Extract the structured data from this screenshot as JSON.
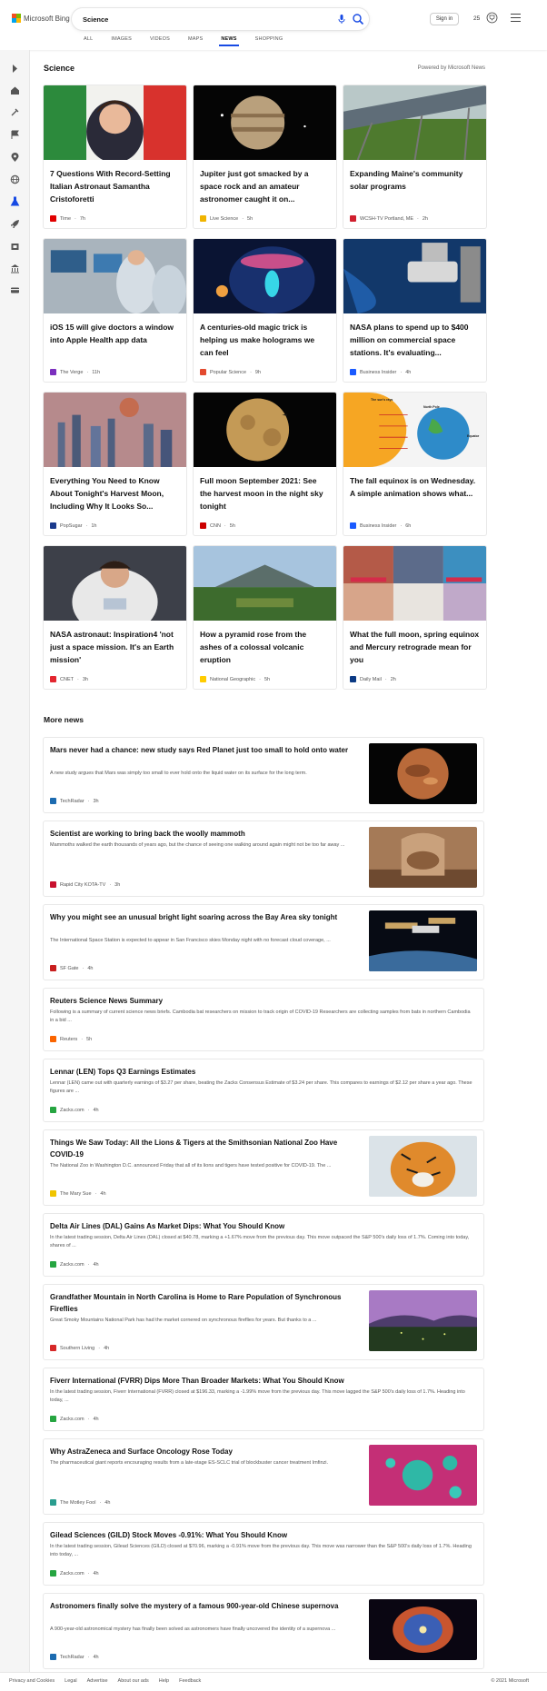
{
  "brand": {
    "name": "Microsoft Bing",
    "colors": [
      "#f25022",
      "#7fba00",
      "#00a4ef",
      "#ffb900"
    ]
  },
  "search": {
    "query": "Science"
  },
  "header": {
    "signin_label": "Sign in",
    "points": "25"
  },
  "tabs": [
    {
      "label": "ALL",
      "active": false
    },
    {
      "label": "IMAGES",
      "active": false
    },
    {
      "label": "VIDEOS",
      "active": false
    },
    {
      "label": "MAPS",
      "active": false
    },
    {
      "label": "NEWS",
      "active": true
    },
    {
      "label": "SHOPPING",
      "active": false
    }
  ],
  "rail_icons": [
    "expand-arrow-icon",
    "home-icon",
    "tools-icon",
    "flag-icon",
    "location-pin-icon",
    "globe-icon",
    "flask-icon",
    "rocket-icon",
    "film-icon",
    "bank-icon",
    "card-icon"
  ],
  "section": {
    "title": "Science",
    "powered_by": "Powered by Microsoft News"
  },
  "cards": [
    {
      "title": "7 Questions With Record-Setting Italian Astronaut Samantha Cristoforetti",
      "source": "Time",
      "age": "7h",
      "logo_color": "#e10000",
      "img": "astronaut-portrait"
    },
    {
      "title": "Jupiter just got smacked by a space rock and an amateur astronomer caught it on...",
      "source": "Live Science",
      "age": "5h",
      "logo_color": "#f0b400",
      "img": "jupiter"
    },
    {
      "title": "Expanding Maine's community solar programs",
      "source": "WCSH-TV Portland, ME",
      "age": "2h",
      "logo_color": "#d01f2e",
      "img": "solar"
    },
    {
      "title": "iOS 15 will give doctors a window into Apple Health app data",
      "source": "The Verge",
      "age": "11h",
      "logo_color": "#7b2fbe",
      "img": "lab"
    },
    {
      "title": "A centuries-old magic trick is helping us make holograms we can feel",
      "source": "Popular Science",
      "age": "9h",
      "logo_color": "#e34a2f",
      "img": "hologram"
    },
    {
      "title": "NASA plans to spend up to $400 million on commercial space stations. It's evaluating...",
      "source": "Business Insider",
      "age": "4h",
      "logo_color": "#1a5aff",
      "img": "station"
    },
    {
      "title": "Everything You Need to Know About Tonight's Harvest Moon, Including Why It Looks So...",
      "source": "PopSugar",
      "age": "1h",
      "logo_color": "#1b3a8c",
      "img": "city-moon"
    },
    {
      "title": "Full moon September 2021: See the harvest moon in the night sky tonight",
      "source": "CNN",
      "age": "5h",
      "logo_color": "#cc0000",
      "img": "full-moon"
    },
    {
      "title": "The fall equinox is on Wednesday. A simple animation shows what...",
      "source": "Business Insider",
      "age": "6h",
      "logo_color": "#1a5aff",
      "img": "equinox"
    },
    {
      "title": "NASA astronaut: Inspiration4 'not just a space mission. It's an Earth mission'",
      "source": "CNET",
      "age": "3h",
      "logo_color": "#e3262f",
      "img": "suit"
    },
    {
      "title": "How a pyramid rose from the ashes of a colossal volcanic eruption",
      "source": "National Geographic",
      "age": "5h",
      "logo_color": "#ffcc00",
      "img": "volcano"
    },
    {
      "title": "What the full moon, spring equinox and Mercury retrograde mean for you",
      "source": "Daily Mail",
      "age": "2h",
      "logo_color": "#0b3a84",
      "img": "collage"
    }
  ],
  "equinox_labels": {
    "sun_rays": "The sun's rays",
    "north_pole": "North Pole",
    "equator": "Equator"
  },
  "more_news": {
    "title": "More news",
    "items": [
      {
        "title": "Mars never had a chance: new study says Red Planet just too small to hold onto water",
        "snippet": "A new study argues that Mars was simply too small to ever hold onto the liquid water on its surface for the long term.",
        "source": "TechRadar",
        "age": "3h",
        "logo_color": "#1c6bb0",
        "img": "mars"
      },
      {
        "title": "Scientist are working to bring back the woolly mammoth",
        "snippet": "Mammoths walked the earth thousands of years ago, but the chance of seeing one walking around again might not be too far away ...",
        "source": "Rapid City KOTA-TV",
        "age": "3h",
        "logo_color": "#c8102e",
        "img": "museum"
      },
      {
        "title": "Why you might see an unusual bright light soaring across the Bay Area sky tonight",
        "snippet": "The International Space Station is expected to appear in San Francisco skies Monday night with no forecast cloud coverage, ...",
        "source": "SF Gate",
        "age": "4h",
        "logo_color": "#c81e1e",
        "img": "iss"
      },
      {
        "title": "Reuters Science News Summary",
        "snippet": "Following is a summary of current science news briefs. Cambodia bat researchers on mission to track origin of COVID-19 Researchers are collecting samples from bats in northern Cambodia in a bid ...",
        "source": "Reuters",
        "age": "5h",
        "logo_color": "#fa6400",
        "img": ""
      },
      {
        "title": "Lennar (LEN) Tops Q3 Earnings Estimates",
        "snippet": "Lennar (LEN) came out with quarterly earnings of $3.27 per share, beating the Zacks Consensus Estimate of $3.24 per share. This compares to earnings of $2.12 per share a year ago. These figures are ...",
        "source": "Zacks.com",
        "age": "4h",
        "logo_color": "#26a541",
        "img": ""
      },
      {
        "title": "Things We Saw Today: All the Lions & Tigers at the Smithsonian National Zoo Have COVID-19",
        "snippet": "The National Zoo in Washington D.C. announced Friday that all of its lions and tigers have tested positive for COVID-19. The ...",
        "source": "The Mary Sue",
        "age": "4h",
        "logo_color": "#f0c400",
        "img": "tiger"
      },
      {
        "title": "Delta Air Lines (DAL) Gains As Market Dips: What You Should Know",
        "snippet": "In the latest trading session, Delta Air Lines (DAL) closed at $40.78, marking a +1.67% move from the previous day. This move outpaced the S&P 500's daily loss of 1.7%. Coming into today, shares of ...",
        "source": "Zacks.com",
        "age": "4h",
        "logo_color": "#26a541",
        "img": ""
      },
      {
        "title": "Grandfather Mountain in North Carolina is Home to Rare Population of Synchronous Fireflies",
        "snippet": "Great Smoky Mountains National Park has had the market cornered on synchronous fireflies for years. But thanks to a ...",
        "source": "Southern Living",
        "age": "4h",
        "logo_color": "#d62828",
        "img": "fireflies"
      },
      {
        "title": "Fiverr International (FVRR) Dips More Than Broader Markets: What You Should Know",
        "snippet": "In the latest trading session, Fiverr International (FVRR) closed at $196.33, marking a -1.99% move from the previous day. This move lagged the S&P 500's daily loss of 1.7%. Heading into today, ...",
        "source": "Zacks.com",
        "age": "4h",
        "logo_color": "#26a541",
        "img": ""
      },
      {
        "title": "Why AstraZeneca and Surface Oncology Rose Today",
        "snippet": "The pharmaceutical giant reports encouraging results from a late-stage ES-SCLC trial of blockbuster cancer treatment Imfinzi.",
        "source": "The Motley Fool",
        "age": "4h",
        "logo_color": "#2a9d8f",
        "img": "cells"
      },
      {
        "title": "Gilead Sciences (GILD) Stock Moves -0.91%: What You Should Know",
        "snippet": "In the latest trading session, Gilead Sciences (GILD) closed at $70.96, marking a -0.91% move from the previous day. This move was narrower than the S&P 500's daily loss of 1.7%. Heading into today, ...",
        "source": "Zacks.com",
        "age": "4h",
        "logo_color": "#26a541",
        "img": ""
      },
      {
        "title": "Astronomers finally solve the mystery of a famous 900-year-old Chinese supernova",
        "snippet": "A 900-year-old astronomical mystery has finally been solved as astronomers have finally uncovered the identity of a supernova ...",
        "source": "TechRadar",
        "age": "4h",
        "logo_color": "#1c6bb0",
        "img": "nebula"
      }
    ]
  },
  "footer": {
    "links": [
      "Privacy and Cookies",
      "Legal",
      "Advertise",
      "About our ads",
      "Help",
      "Feedback"
    ],
    "copyright": "© 2021 Microsoft"
  }
}
